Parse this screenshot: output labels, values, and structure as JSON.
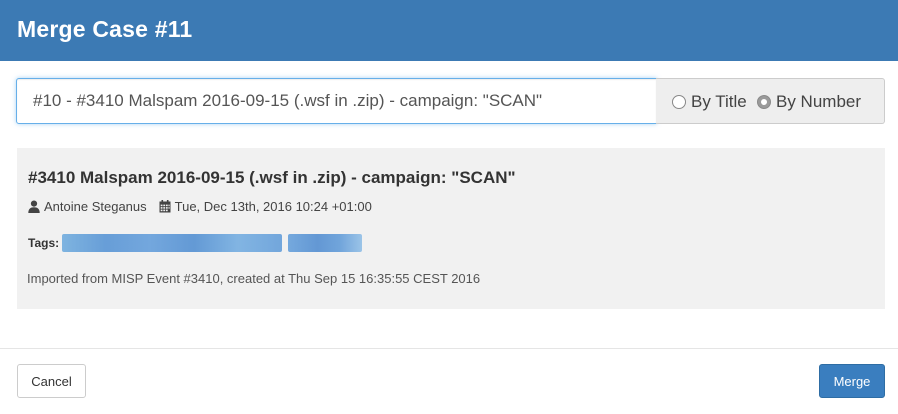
{
  "modal": {
    "title": "Merge Case #11"
  },
  "search": {
    "value": "#10 - #3410 Malspam 2016-09-15 (.wsf in .zip) - campaign: \"SCAN\"",
    "options": [
      {
        "label": "By Title",
        "checked": false
      },
      {
        "label": "By Number",
        "checked": true
      }
    ]
  },
  "case": {
    "title": "#3410 Malspam 2016-09-15 (.wsf in .zip) - campaign: \"SCAN\"",
    "author": "Antoine Steganus",
    "date": "Tue, Dec 13th, 2016 10:24 +01:00",
    "tags_label": "Tags:",
    "description": "Imported from MISP Event #3410, created at Thu Sep 15 16:35:55 CEST 2016"
  },
  "footer": {
    "cancel_label": "Cancel",
    "merge_label": "Merge"
  },
  "colors": {
    "header": "#3c7ab4",
    "primary_button": "#3a7ebf",
    "focus_border": "#66afe9",
    "panel_background": "#f1f1f1"
  },
  "icons": {
    "author": "user-icon",
    "date": "calendar-icon"
  }
}
